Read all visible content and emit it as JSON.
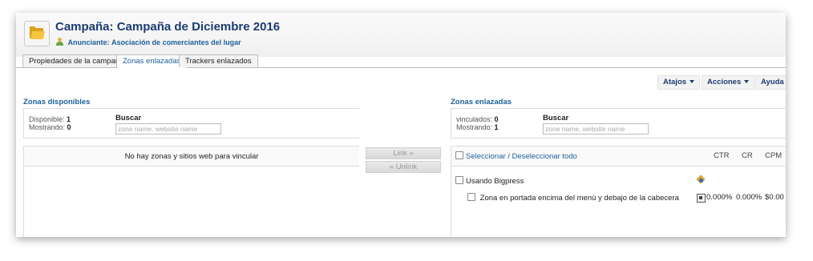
{
  "header": {
    "title_label": "Campaña:",
    "title_value": "Campaña de Diciembre 2016",
    "advertiser_label": "Anunciante:",
    "advertiser_value": "Asociación de comerciantes del lugar"
  },
  "tabs": [
    {
      "label": "Propiedades de la campaña",
      "active": false
    },
    {
      "label": "Zonas enlazadas",
      "active": true
    },
    {
      "label": "Trackers enlazados",
      "active": false
    }
  ],
  "toolbar": {
    "shortcuts_label": "Atajos",
    "actions_label": "Acciones",
    "help_label": "Ayuda"
  },
  "available": {
    "title": "Zonas disponibles",
    "count_label": "Disponible:",
    "count_value": "1",
    "showing_label": "Mostrando:",
    "showing_value": "0",
    "search_label": "Buscar",
    "search_placeholder": "zone name, website name",
    "empty_message": "No hay zonas y sitios web para vincular"
  },
  "middle": {
    "link_label": "Link »",
    "unlink_label": "« Unlink"
  },
  "linked": {
    "title": "Zonas enlazadas",
    "count_label": "vinculados:",
    "count_value": "0",
    "showing_label": "Mostrando:",
    "showing_value": "1",
    "search_label": "Buscar",
    "search_placeholder": "zone name, website name",
    "select_all_label": "Seleccionar / Deseleccionar todo",
    "columns": [
      "CTR",
      "CR",
      "CPM"
    ],
    "website": {
      "name": "Usando Bigpress"
    },
    "zones": [
      {
        "name": "Zona en portada encima del menú y debajo de la cabecera",
        "ctr": "0.000%",
        "cr": "0.000%",
        "cpm": "$0.00"
      }
    ]
  }
}
